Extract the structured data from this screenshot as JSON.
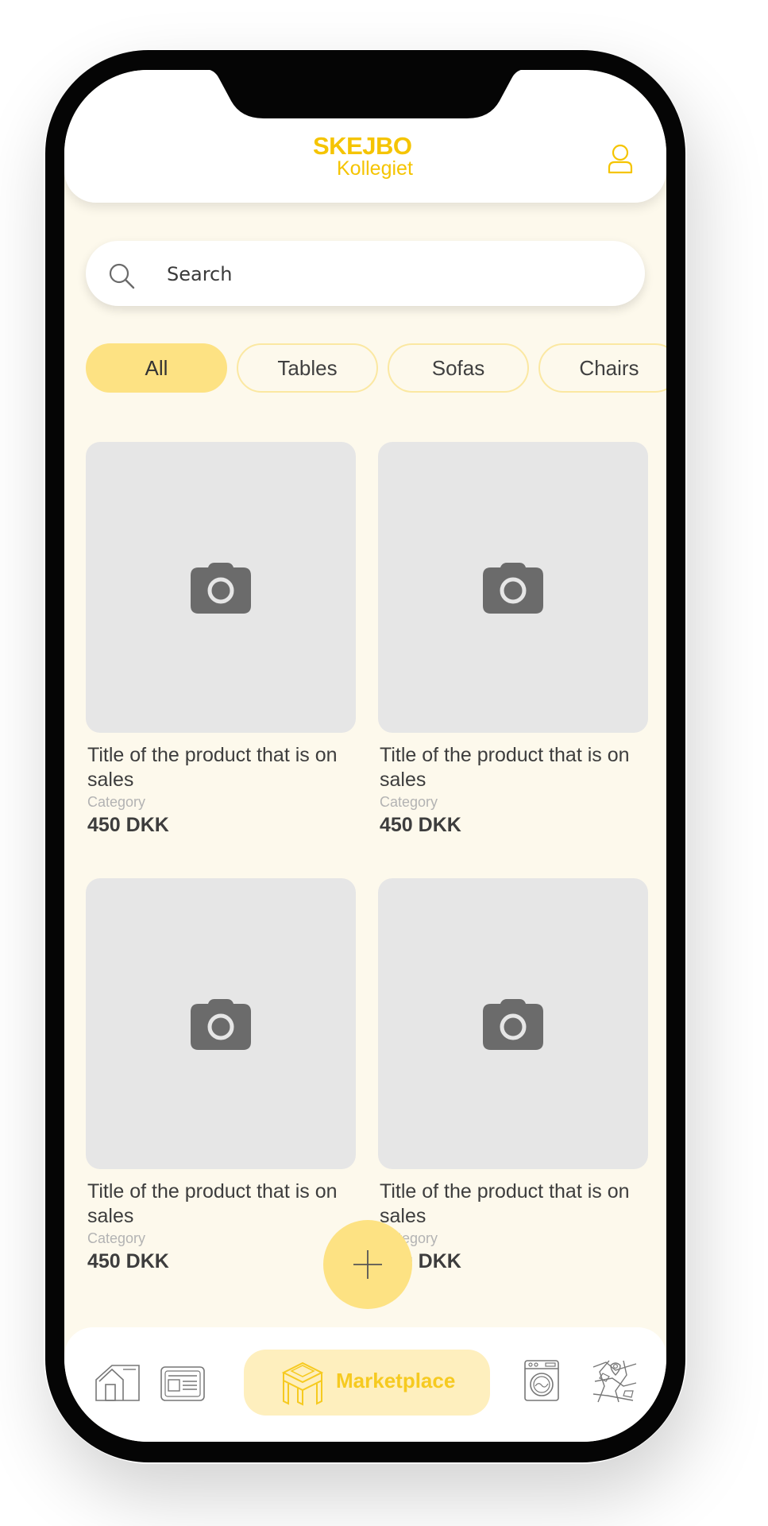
{
  "header": {
    "logo_line1": "SKEJBO",
    "logo_line2": "Kollegiet",
    "profile_icon": "user-icon"
  },
  "search": {
    "placeholder": "Search",
    "icon": "search-icon"
  },
  "categories": [
    {
      "label": "All",
      "active": true
    },
    {
      "label": "Tables",
      "active": false
    },
    {
      "label": "Sofas",
      "active": false
    },
    {
      "label": "Chairs",
      "active": false
    }
  ],
  "products": [
    {
      "title": "Title of the product that is on sales",
      "category": "Category",
      "price": "450 DKK",
      "image_icon": "camera-icon"
    },
    {
      "title": "Title of the product that is on sales",
      "category": "Category",
      "price": "450 DKK",
      "image_icon": "camera-icon"
    },
    {
      "title": "Title of the product that is on sales",
      "category": "Category",
      "price": "450 DKK",
      "image_icon": "camera-icon"
    },
    {
      "title": "Title of the product that is on sales",
      "category": "Category",
      "price": "450 DKK",
      "image_icon": "camera-icon"
    }
  ],
  "fab": {
    "icon": "plus-icon"
  },
  "bottom_nav": {
    "items": [
      {
        "icon": "home-icon"
      },
      {
        "icon": "newspaper-icon"
      },
      {
        "icon": "furniture-icon",
        "label": "Marketplace",
        "active": true
      },
      {
        "icon": "washing-machine-icon"
      },
      {
        "icon": "map-icon"
      }
    ]
  },
  "colors": {
    "accent": "#f5c400",
    "chip_active": "#fde283",
    "background": "#fdf9ec",
    "nav_active_bg": "#feefbe"
  }
}
